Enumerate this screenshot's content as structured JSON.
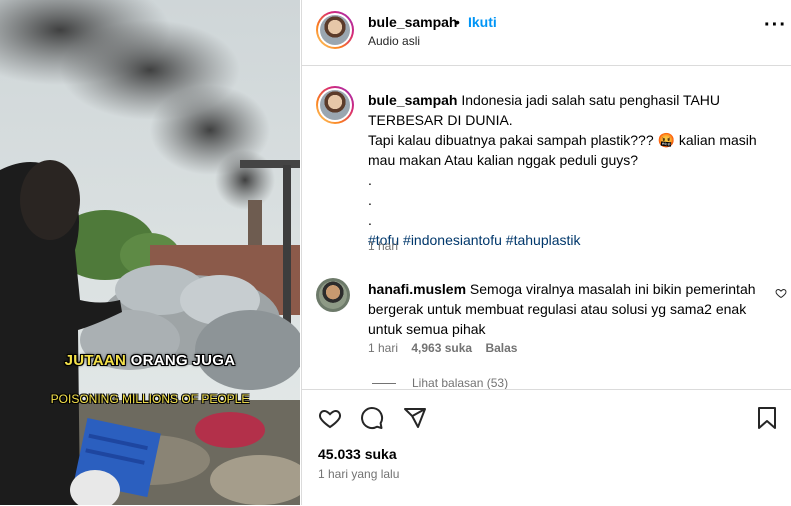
{
  "video": {
    "caption_line1_yellow": "JUTAAN",
    "caption_line1_white": "ORANG JUGA",
    "caption_line2": "POISONING MILLIONS OF PEOPLE"
  },
  "header": {
    "username": "bule_sampah",
    "separator": "•",
    "follow_label": "Ikuti",
    "subtitle": "Audio asli",
    "more_icon": "more-horizontal-icon"
  },
  "post": {
    "username": "bule_sampah",
    "text_line1": "Indonesia jadi salah satu penghasil TAHU TERBESAR DI DUNIA.",
    "text_line2": "Tapi kalau dibuatnya pakai sampah plastik??? 🤬 kalian masih mau makan Atau kalian nggak peduli guys?",
    "dots": [
      ".",
      ".",
      "."
    ],
    "hashtags": [
      "#tofu",
      "#indonesiantofu",
      "#tahuplastik"
    ],
    "time": "1 hari"
  },
  "comment": {
    "username": "hanafi.muslem",
    "text": "Semoga viralnya masalah ini bikin pemerintah bergerak untuk membuat regulasi atau solusi yg sama2 enak untuk semua pihak",
    "time": "1 hari",
    "likes": "4,963 suka",
    "reply_label": "Balas",
    "view_replies": "Lihat balasan (53)"
  },
  "footer": {
    "likes": "45.033 suka",
    "time": "1 hari yang lalu"
  },
  "colors": {
    "link": "#0095f6",
    "hashtag": "#00376b",
    "muted": "#737373"
  }
}
